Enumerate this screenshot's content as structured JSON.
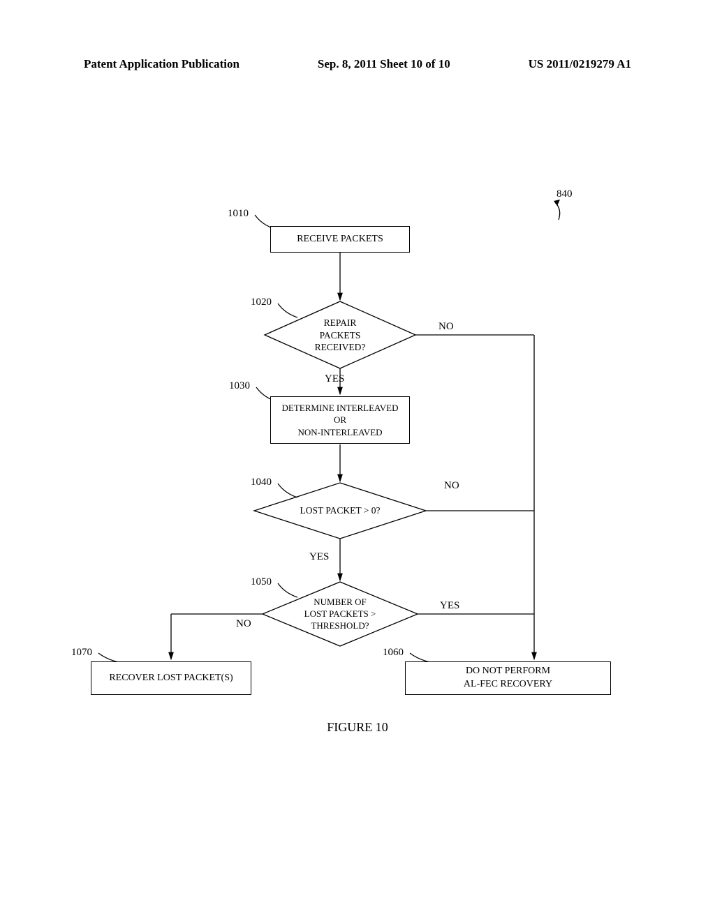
{
  "header": {
    "left": "Patent Application Publication",
    "center": "Sep. 8, 2011  Sheet 10 of 10",
    "right": "US 2011/0219279 A1"
  },
  "refs": {
    "overall": "840",
    "r1010": "1010",
    "r1020": "1020",
    "r1030": "1030",
    "r1040": "1040",
    "r1050": "1050",
    "r1060": "1060",
    "r1070": "1070"
  },
  "boxes": {
    "b1010": "RECEIVE PACKETS",
    "b1020": "REPAIR\nPACKETS\nRECEIVED?",
    "b1030": "DETERMINE INTERLEAVED\nOR\nNON-INTERLEAVED",
    "b1040": "LOST PACKET > 0?",
    "b1050": "NUMBER OF\nLOST PACKETS >\nTHRESHOLD?",
    "b1060": "DO NOT PERFORM\nAL-FEC RECOVERY",
    "b1070": "RECOVER LOST PACKET(S)"
  },
  "branches": {
    "yes": "YES",
    "no": "NO"
  },
  "figure": "FIGURE 10"
}
